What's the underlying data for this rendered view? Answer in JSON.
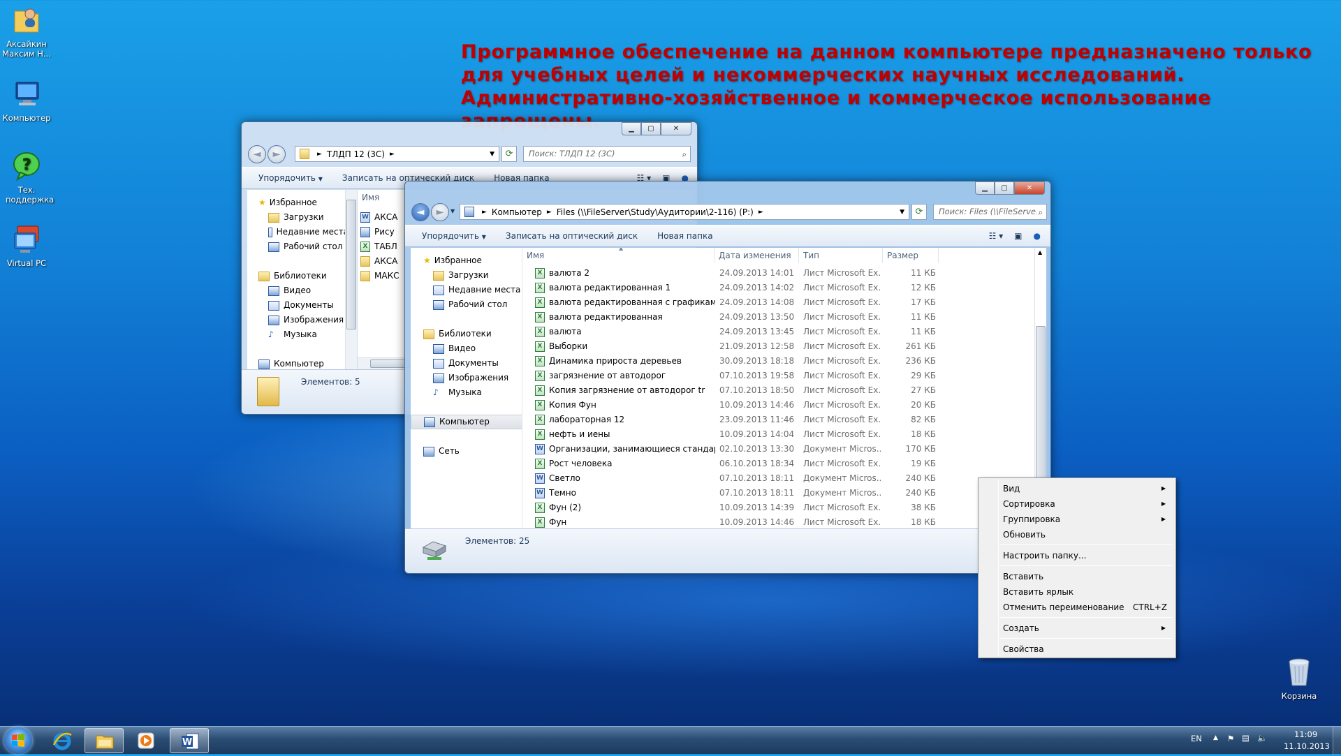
{
  "desktop": {
    "icons": [
      {
        "label": "Аксайкин Максим Н..."
      },
      {
        "label": "Компьютер"
      },
      {
        "label": "Тех. поддержка"
      },
      {
        "label": "Virtual PC"
      },
      {
        "label": "Корзина"
      }
    ],
    "notice": "Программное обеспечение на данном компьютере предназначено только для учебных целей и некоммерческих научных исследований.  Административно-хозяйственное и коммерческое использование запрещены."
  },
  "back_window": {
    "path": [
      "ТЛДП 12 (3С)"
    ],
    "search_placeholder": "Поиск: ТЛДП 12 (3С)",
    "toolbar": {
      "organize": "Упорядочить",
      "burn": "Записать на оптический диск",
      "new_folder": "Новая папка"
    },
    "nav": {
      "favorites": "Избранное",
      "favorites_items": [
        "Загрузки",
        "Недавние места",
        "Рабочий стол"
      ],
      "libraries": "Библиотеки",
      "libraries_items": [
        "Видео",
        "Документы",
        "Изображения",
        "Музыка"
      ],
      "computer": "Компьютер"
    },
    "column_name": "Имя",
    "files": [
      "АКСА",
      "Рису",
      "ТАБЛ",
      "АКСА",
      "МАКС"
    ],
    "status": "Элементов: 5"
  },
  "front_window": {
    "path": [
      "Компьютер",
      "Files (\\\\FileServer\\Study\\Аудитории\\2-116) (P:)"
    ],
    "search_placeholder": "Поиск: Files (\\\\FileServer\\Study\\Ауди...",
    "toolbar": {
      "organize": "Упорядочить",
      "burn": "Записать на оптический диск",
      "new_folder": "Новая папка"
    },
    "nav": {
      "favorites": "Избранное",
      "favorites_items": [
        "Загрузки",
        "Недавние места",
        "Рабочий стол"
      ],
      "libraries": "Библиотеки",
      "libraries_items": [
        "Видео",
        "Документы",
        "Изображения",
        "Музыка"
      ],
      "computer": "Компьютер",
      "network": "Сеть"
    },
    "columns": {
      "name": "Имя",
      "date": "Дата изменения",
      "type": "Тип",
      "size": "Размер"
    },
    "files": [
      {
        "name": "валюта 2",
        "date": "24.09.2013 14:01",
        "type": "Лист Microsoft Ex...",
        "size": "11 КБ",
        "kind": "xls"
      },
      {
        "name": "валюта редактированная 1",
        "date": "24.09.2013 14:02",
        "type": "Лист Microsoft Ex...",
        "size": "12 КБ",
        "kind": "xls"
      },
      {
        "name": "валюта редактированная с графиками",
        "date": "24.09.2013 14:08",
        "type": "Лист Microsoft Ex...",
        "size": "17 КБ",
        "kind": "xls"
      },
      {
        "name": "валюта редактированная",
        "date": "24.09.2013 13:50",
        "type": "Лист Microsoft Ex...",
        "size": "11 КБ",
        "kind": "xls"
      },
      {
        "name": "валюта",
        "date": "24.09.2013 13:45",
        "type": "Лист Microsoft Ex...",
        "size": "11 КБ",
        "kind": "xls"
      },
      {
        "name": "Выборки",
        "date": "21.09.2013 12:58",
        "type": "Лист Microsoft Ex...",
        "size": "261 КБ",
        "kind": "xls"
      },
      {
        "name": "Динамика прироста деревьев",
        "date": "30.09.2013 18:18",
        "type": "Лист Microsoft Ex...",
        "size": "236 КБ",
        "kind": "xls"
      },
      {
        "name": "загрязнение от автодорог",
        "date": "07.10.2013 19:58",
        "type": "Лист Microsoft Ex...",
        "size": "29 КБ",
        "kind": "xls"
      },
      {
        "name": "Копия загрязнение от автодорог  tr",
        "date": "07.10.2013 18:50",
        "type": "Лист Microsoft Ex...",
        "size": "27 КБ",
        "kind": "xls"
      },
      {
        "name": "Копия Фун",
        "date": "10.09.2013 14:46",
        "type": "Лист Microsoft Ex...",
        "size": "20 КБ",
        "kind": "xls"
      },
      {
        "name": "лабораторная 12",
        "date": "23.09.2013 11:46",
        "type": "Лист Microsoft Ex...",
        "size": "82 КБ",
        "kind": "xls"
      },
      {
        "name": "нефть и иены",
        "date": "10.09.2013 14:04",
        "type": "Лист Microsoft Ex...",
        "size": "18 КБ",
        "kind": "xls"
      },
      {
        "name": "Организации, занимающиеся стандарт...",
        "date": "02.10.2013 13:30",
        "type": "Документ Micros...",
        "size": "170 КБ",
        "kind": "doc"
      },
      {
        "name": "Рост человека",
        "date": "06.10.2013 18:34",
        "type": "Лист Microsoft Ex...",
        "size": "19 КБ",
        "kind": "xls"
      },
      {
        "name": "Светло",
        "date": "07.10.2013 18:11",
        "type": "Документ Micros...",
        "size": "240 КБ",
        "kind": "doc"
      },
      {
        "name": "Темно",
        "date": "07.10.2013 18:11",
        "type": "Документ Micros...",
        "size": "240 КБ",
        "kind": "doc"
      },
      {
        "name": "Фун (2)",
        "date": "10.09.2013 14:39",
        "type": "Лист Microsoft Ex...",
        "size": "38 КБ",
        "kind": "xls"
      },
      {
        "name": "Фун",
        "date": "10.09.2013 14:46",
        "type": "Лист Microsoft Ex...",
        "size": "18 КБ",
        "kind": "xls"
      }
    ],
    "status": "Элементов: 25"
  },
  "context_menu": {
    "view": "Вид",
    "sort": "Сортировка",
    "group": "Группировка",
    "refresh": "Обновить",
    "customize": "Настроить папку...",
    "paste": "Вставить",
    "paste_shortcut": "Вставить ярлык",
    "undo_rename": "Отменить переименование",
    "undo_shortcut": "CTRL+Z",
    "new": "Создать",
    "properties": "Свойства"
  },
  "taskbar": {
    "language": "EN",
    "time": "11:09",
    "date": "11.10.2013"
  },
  "colors": {
    "notice": "#c00000",
    "accent": "#2b62b8"
  }
}
